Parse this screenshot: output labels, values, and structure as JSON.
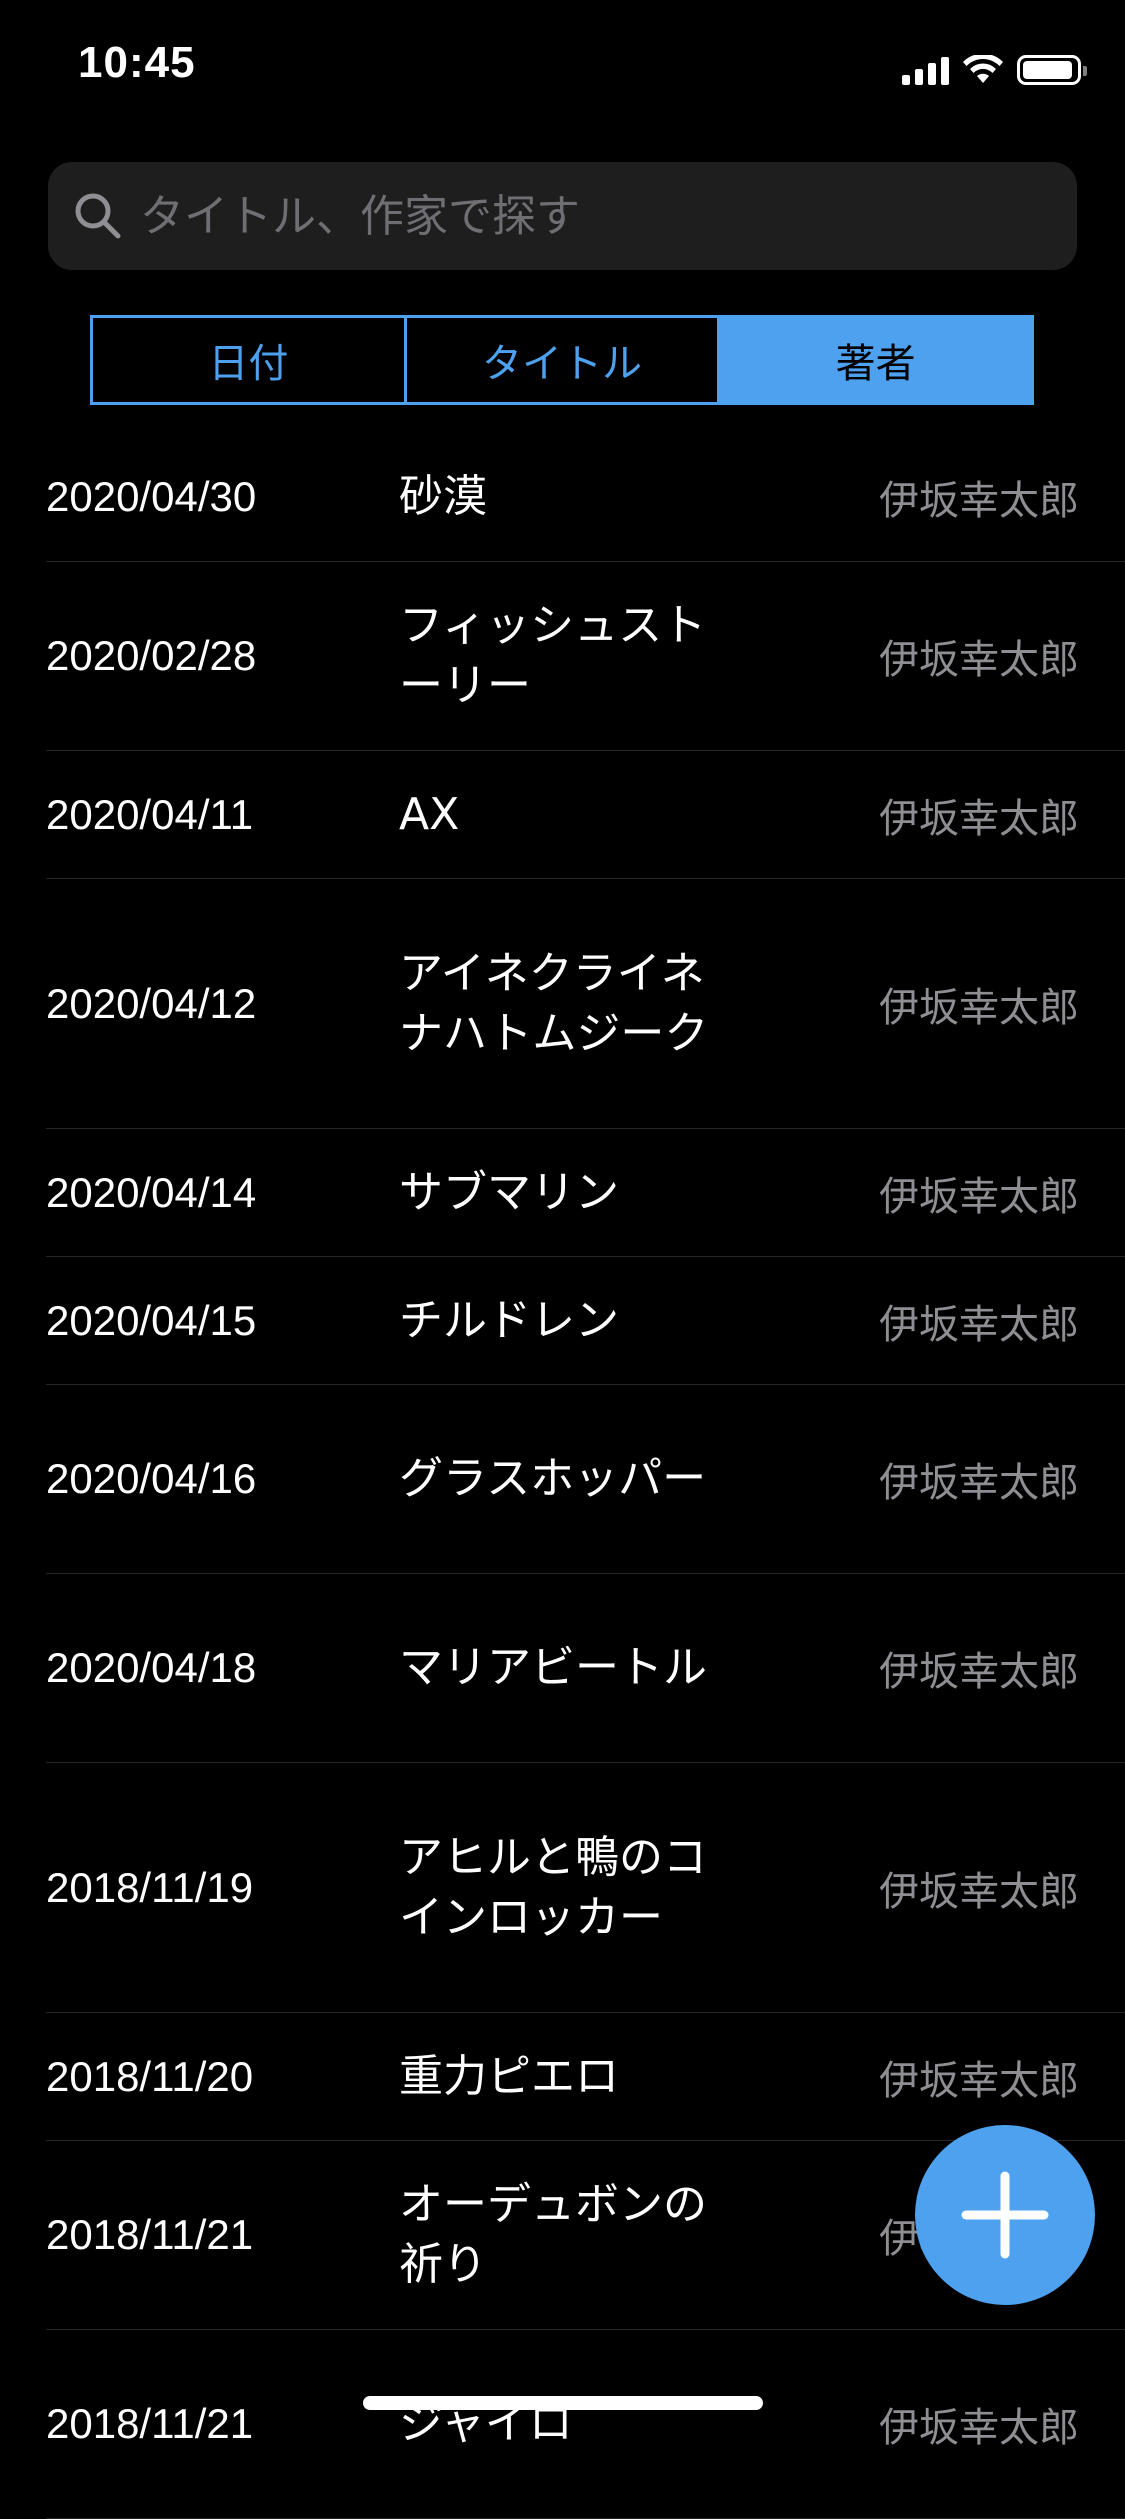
{
  "status_bar": {
    "time": "10:45"
  },
  "search": {
    "placeholder": "タイトル、作家で探す"
  },
  "segments": [
    {
      "label": "日付",
      "active": false
    },
    {
      "label": "タイトル",
      "active": false
    },
    {
      "label": "著者",
      "active": true
    }
  ],
  "books": [
    {
      "date": "2020/04/30",
      "title": "砂漠",
      "author": "伊坂幸太郎"
    },
    {
      "date": "2020/02/28",
      "title": "フィッシュストーリー",
      "author": "伊坂幸太郎"
    },
    {
      "date": "2020/04/11",
      "title": "AX",
      "author": "伊坂幸太郎"
    },
    {
      "date": "2020/04/12",
      "title": "アイネクライネナハトムジーク",
      "author": "伊坂幸太郎"
    },
    {
      "date": "2020/04/14",
      "title": "サブマリン",
      "author": "伊坂幸太郎"
    },
    {
      "date": "2020/04/15",
      "title": "チルドレン",
      "author": "伊坂幸太郎"
    },
    {
      "date": "2020/04/16",
      "title": "グラスホッパー",
      "author": "伊坂幸太郎"
    },
    {
      "date": "2020/04/18",
      "title": "マリアビートル",
      "author": "伊坂幸太郎"
    },
    {
      "date": "2018/11/19",
      "title": "アヒルと鴨のコインロッカー",
      "author": "伊坂幸太郎"
    },
    {
      "date": "2018/11/20",
      "title": "重力ピエロ",
      "author": "伊坂幸太郎"
    },
    {
      "date": "2018/11/21",
      "title": "オーデュボンの祈り",
      "author": "伊坂幸太郎"
    },
    {
      "date": "2018/11/21",
      "title": "ジャイロ",
      "author": "伊坂幸太郎"
    }
  ],
  "icons": {
    "search": "search-icon",
    "add": "plus-icon"
  },
  "colors": {
    "accent": "#4da1ee",
    "background": "#000000",
    "search_field": "#1e1e1e"
  }
}
